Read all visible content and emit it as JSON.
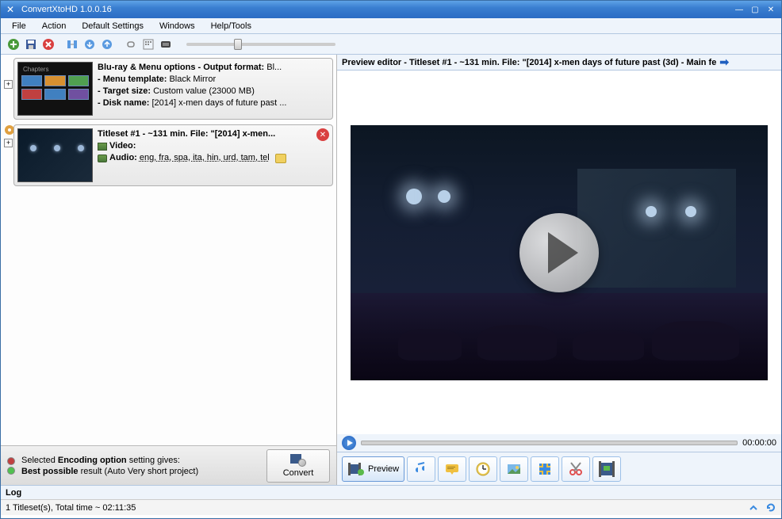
{
  "window": {
    "title": "ConvertXtoHD 1.0.0.16"
  },
  "menu": {
    "file": "File",
    "action": "Action",
    "defaults": "Default Settings",
    "windows": "Windows",
    "help": "Help/Tools"
  },
  "tree": {
    "card1": {
      "title": "Blu-ray & Menu options - Output format: ",
      "title_suffix": "Bl...",
      "menu_label": "- Menu template: ",
      "menu_value": "Black Mirror",
      "target_label": "- Target size: ",
      "target_value": "Custom value (23000 MB)",
      "disk_label": "- Disk name: ",
      "disk_value": "[2014] x-men days of future past ..."
    },
    "card2": {
      "title": "Titleset #1 - ~131 min. File: \"[2014] x-men...",
      "video_label": "Video:",
      "audio_label": "Audio: ",
      "audio_value": "eng, fra, spa, ita, hin, urd, tam, tel"
    }
  },
  "encoding": {
    "line1_a": "Selected ",
    "line1_b": "Encoding option",
    "line1_c": " setting gives:",
    "line2_a": "Best possible",
    "line2_b": " result (Auto Very short project)"
  },
  "convert_btn": "Convert",
  "preview_header": "Preview editor - Titleset #1 - ~131 min. File: \"[2014] x-men days of future past (3d) - Main fe",
  "controls": {
    "time": "00:00:00"
  },
  "tabs": {
    "preview": "Preview"
  },
  "log_label": "Log",
  "status": {
    "text": "1 Titleset(s), Total time ~ 02:11:35"
  }
}
